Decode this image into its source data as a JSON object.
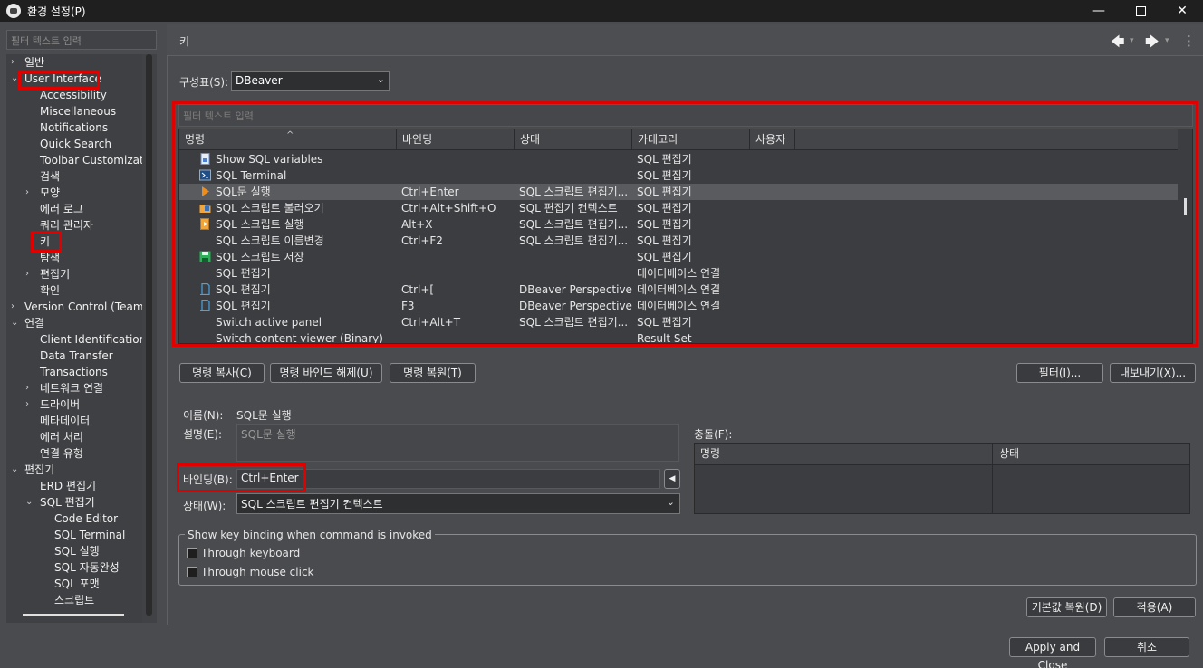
{
  "window": {
    "title": "환경 설정(P)",
    "min": "—",
    "close": "✕"
  },
  "left": {
    "filter_placeholder": "필터 텍스트 입력",
    "tree": [
      {
        "label": "일반",
        "level": 0,
        "arrow": "›"
      },
      {
        "label": "User Interface",
        "level": 0,
        "arrow": "⌄"
      },
      {
        "label": "Accessibility",
        "level": 1
      },
      {
        "label": "Miscellaneous",
        "level": 1
      },
      {
        "label": "Notifications",
        "level": 1
      },
      {
        "label": "Quick Search",
        "level": 1
      },
      {
        "label": "Toolbar Customizatio",
        "level": 1
      },
      {
        "label": "검색",
        "level": 1
      },
      {
        "label": "모양",
        "level": 1,
        "arrow": "›"
      },
      {
        "label": "에러 로그",
        "level": 1
      },
      {
        "label": "쿼리 관리자",
        "level": 1
      },
      {
        "label": "키",
        "level": 1
      },
      {
        "label": "탐색",
        "level": 1
      },
      {
        "label": "편집기",
        "level": 1,
        "arrow": "›"
      },
      {
        "label": "확인",
        "level": 1
      },
      {
        "label": "Version Control (Team)",
        "level": 0,
        "arrow": "›"
      },
      {
        "label": "연결",
        "level": 0,
        "arrow": "⌄"
      },
      {
        "label": "Client Identification",
        "level": 1
      },
      {
        "label": "Data Transfer",
        "level": 1
      },
      {
        "label": "Transactions",
        "level": 1
      },
      {
        "label": "네트워크 연결",
        "level": 1,
        "arrow": "›"
      },
      {
        "label": "드라이버",
        "level": 1,
        "arrow": "›"
      },
      {
        "label": "메타데이터",
        "level": 1
      },
      {
        "label": "에러 처리",
        "level": 1
      },
      {
        "label": "연결 유형",
        "level": 1
      },
      {
        "label": "편집기",
        "level": 0,
        "arrow": "⌄"
      },
      {
        "label": "ERD 편집기",
        "level": 1
      },
      {
        "label": "SQL 편집기",
        "level": 1,
        "arrow": "⌄"
      },
      {
        "label": "Code Editor",
        "level": 2
      },
      {
        "label": "SQL Terminal",
        "level": 2
      },
      {
        "label": "SQL 실행",
        "level": 2
      },
      {
        "label": "SQL 자동완성",
        "level": 2
      },
      {
        "label": "SQL 포맷",
        "level": 2
      },
      {
        "label": "스크립트",
        "level": 2
      }
    ]
  },
  "page": {
    "title": "키",
    "back_icon": "🡄",
    "forward_icon": "🡆",
    "menu_icon": "⋮",
    "dropdown_icon": "▾"
  },
  "scheme": {
    "label": "구성표(S):",
    "value": "DBeaver",
    "arrow": "⌄"
  },
  "filter_placeholder": "필터 텍스트 입력",
  "table": {
    "sort_indicator": "^",
    "headers": [
      "명령",
      "바인딩",
      "상태",
      "카테고리",
      "사용자"
    ],
    "rows": [
      {
        "icon": "doc",
        "name": "Show SQL variables",
        "binding": "",
        "state": "",
        "category": "SQL 편집기"
      },
      {
        "icon": "terminal",
        "name": "SQL Terminal",
        "binding": "",
        "state": "",
        "category": "SQL 편집기"
      },
      {
        "icon": "run",
        "name": "SQL문 실행",
        "binding": "Ctrl+Enter",
        "state": "SQL 스크립트 편집기...",
        "category": "SQL 편집기",
        "selected": true
      },
      {
        "icon": "folder",
        "name": "SQL 스크립트 불러오기",
        "binding": "Ctrl+Alt+Shift+O",
        "state": "SQL 편집기 컨텍스트",
        "category": "SQL 편집기"
      },
      {
        "icon": "script",
        "name": "SQL 스크립트 실행",
        "binding": "Alt+X",
        "state": "SQL 스크립트 편집기...",
        "category": "SQL 편집기"
      },
      {
        "icon": "",
        "name": "SQL 스크립트 이름변경",
        "binding": "Ctrl+F2",
        "state": "SQL 스크립트 편집기...",
        "category": "SQL 편집기"
      },
      {
        "icon": "save",
        "name": "SQL 스크립트 저장",
        "binding": "",
        "state": "",
        "category": "SQL 편집기"
      },
      {
        "icon": "",
        "name": "SQL 편집기",
        "binding": "",
        "state": "",
        "category": "데이터베이스 연결"
      },
      {
        "icon": "sqledit",
        "name": "SQL 편집기",
        "binding": "Ctrl+[",
        "state": "DBeaver Perspective",
        "category": "데이터베이스 연결"
      },
      {
        "icon": "sqledit",
        "name": "SQL 편집기",
        "binding": "F3",
        "state": "DBeaver Perspective",
        "category": "데이터베이스 연결"
      },
      {
        "icon": "",
        "name": "Switch active panel",
        "binding": "Ctrl+Alt+T",
        "state": "SQL 스크립트 편집기...",
        "category": "SQL 편집기"
      },
      {
        "icon": "",
        "name": "Switch content viewer (Binary)",
        "binding": "",
        "state": "",
        "category": "Result Set"
      }
    ]
  },
  "buttons": {
    "copy": "명령 복사(C)",
    "unbind": "명령 바인드 해제(U)",
    "restore": "명령 복원(T)",
    "filters": "필터(I)...",
    "export": "내보내기(X)...",
    "restore_defaults": "기본값 복원(D)",
    "apply": "적용(A)",
    "apply_close": "Apply and Close",
    "cancel": "취소"
  },
  "details": {
    "name_label": "이름(N):",
    "name_value": "SQL문 실행",
    "desc_label": "설명(E):",
    "desc_value": "SQL문 실행",
    "binding_label": "바인딩(B):",
    "binding_value": "Ctrl+Enter",
    "binding_btn": "◀",
    "when_label": "상태(W):",
    "when_value": "SQL 스크립트 편집기 컨텍스트",
    "when_arrow": "⌄"
  },
  "conflicts": {
    "label": "충돌(F):",
    "headers": [
      "명령",
      "상태"
    ]
  },
  "keybinding_group": {
    "title": "Show key binding when command is invoked",
    "keyboard": "Through keyboard",
    "mouse": "Through mouse click"
  },
  "colors": {
    "highlight": "#e00000",
    "background": "#4a4b4e"
  }
}
